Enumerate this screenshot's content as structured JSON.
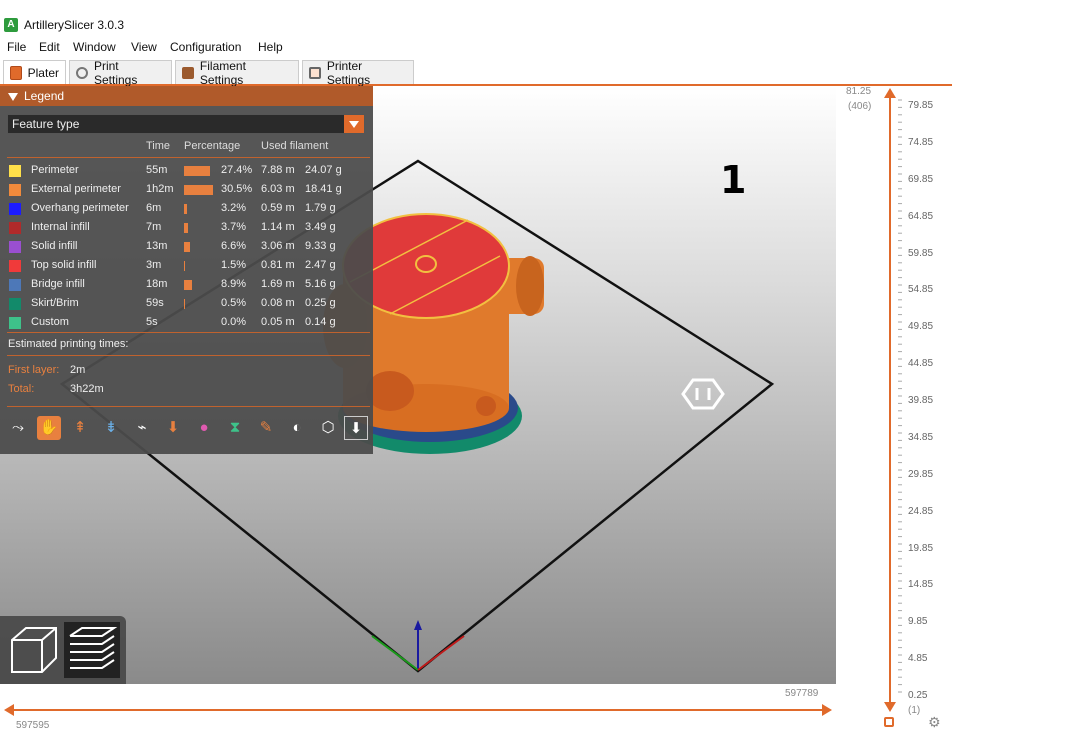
{
  "window": {
    "title": "ArtillerySlicer 3.0.3"
  },
  "menu": [
    "File",
    "Edit",
    "Window",
    "View",
    "Configuration",
    "Help"
  ],
  "tabs": [
    {
      "label": "Plater",
      "icon": "plater-icon",
      "active": true
    },
    {
      "label": "Print Settings",
      "icon": "print-settings-icon",
      "active": false
    },
    {
      "label": "Filament Settings",
      "icon": "filament-spool-icon",
      "active": false
    },
    {
      "label": "Printer Settings",
      "icon": "printer-icon",
      "active": false
    }
  ],
  "legend": {
    "title": "Legend",
    "view_type": "Feature type",
    "columns": [
      "Time",
      "Percentage",
      "Used filament"
    ],
    "rows": [
      {
        "name": "Perimeter",
        "color": "#ffe04a",
        "time": "55m",
        "percent": "27.4%",
        "pct": 27.4,
        "length": "7.88 m",
        "weight": "24.07 g"
      },
      {
        "name": "External perimeter",
        "color": "#f08a3c",
        "time": "1h2m",
        "percent": "30.5%",
        "pct": 30.5,
        "length": "6.03 m",
        "weight": "18.41 g"
      },
      {
        "name": "Overhang perimeter",
        "color": "#1c1cff",
        "time": "6m",
        "percent": "3.2%",
        "pct": 3.2,
        "length": "0.59 m",
        "weight": "1.79 g"
      },
      {
        "name": "Internal infill",
        "color": "#b02a2a",
        "time": "7m",
        "percent": "3.7%",
        "pct": 3.7,
        "length": "1.14 m",
        "weight": "3.49 g"
      },
      {
        "name": "Solid infill",
        "color": "#9a4fd0",
        "time": "13m",
        "percent": "6.6%",
        "pct": 6.6,
        "length": "3.06 m",
        "weight": "9.33 g"
      },
      {
        "name": "Top solid infill",
        "color": "#f03a3a",
        "time": "3m",
        "percent": "1.5%",
        "pct": 1.5,
        "length": "0.81 m",
        "weight": "2.47 g"
      },
      {
        "name": "Bridge infill",
        "color": "#4d78b8",
        "time": "18m",
        "percent": "8.9%",
        "pct": 8.9,
        "length": "1.69 m",
        "weight": "5.16 g"
      },
      {
        "name": "Skirt/Brim",
        "color": "#128a6a",
        "time": "59s",
        "percent": "0.5%",
        "pct": 0.5,
        "length": "0.08 m",
        "weight": "0.25 g"
      },
      {
        "name": "Custom",
        "color": "#3ec28a",
        "time": "5s",
        "percent": "0.0%",
        "pct": 0.0,
        "length": "0.05 m",
        "weight": "0.14 g"
      }
    ],
    "estimated_label": "Estimated printing times:",
    "first_layer_label": "First layer:",
    "first_layer_value": "2m",
    "total_label": "Total:",
    "total_value": "3h22m",
    "option_icons": [
      "travel-icon",
      "wipe-icon",
      "retractions-icon",
      "deretractions-icon",
      "seams-icon",
      "tool-changes-icon",
      "color-changes-icon",
      "pause-icon",
      "custom-gcode-icon",
      "center-of-gravity-icon",
      "shells-icon",
      "tool-marker-icon"
    ]
  },
  "viewport": {
    "object_label": "1"
  },
  "layer_slider": {
    "top_value": "81.25",
    "top_layer": "(406)",
    "ticks": [
      "79.85",
      "74.85",
      "69.85",
      "64.85",
      "59.85",
      "54.85",
      "49.85",
      "44.85",
      "39.85",
      "34.85",
      "29.85",
      "24.85",
      "19.85",
      "14.85",
      "9.85",
      "4.85",
      "0.25"
    ],
    "bottom_layer": "(1)"
  },
  "move_slider": {
    "right_value": "597789",
    "left_value": "597595"
  },
  "colors": {
    "accent": "#e06a2b",
    "legend_bg": "#4b4b4b"
  }
}
